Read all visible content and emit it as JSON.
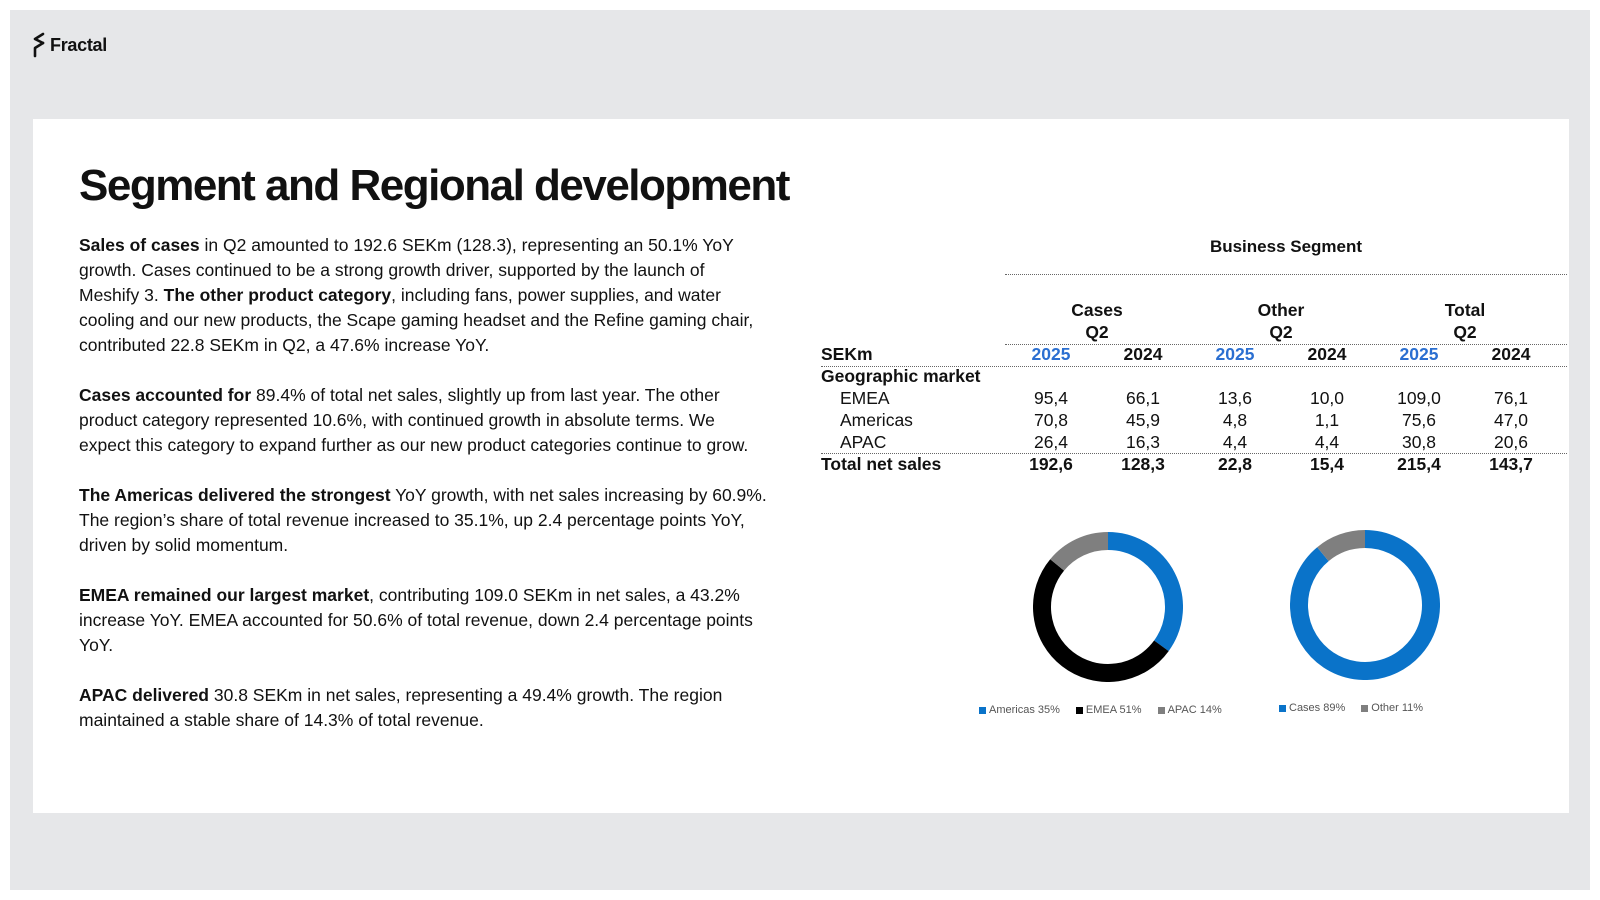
{
  "brand": {
    "name": "Fractal"
  },
  "title": "Segment and Regional development",
  "paragraphs": [
    {
      "bold": "Sales of cases",
      "rest": " in Q2 amounted to 192.6 SEKm (128.3), representing an 50.1% YoY growth. Cases continued to be a strong growth driver, supported by the launch of Meshify 3. ",
      "bold2": "The other product category",
      "rest2": ", including fans, power supplies, and water cooling and our new products, the Scape gaming headset and the Refine gaming chair, contributed 22.8 SEKm in Q2, a 47.6% increase YoY."
    },
    {
      "bold": "Cases accounted for",
      "rest": " 89.4% of total net sales, slightly up from last year. The other product category represented 10.6%, with continued growth in absolute terms. We expect this category to expand further as our new product categories continue to grow."
    },
    {
      "bold": "The Americas delivered the strongest",
      "rest": " YoY growth, with net sales increasing by 60.9%. The region’s share of total revenue increased to 35.1%, up 2.4 percentage points YoY, driven by solid momentum."
    },
    {
      "bold": "EMEA remained our largest market",
      "rest": ", contributing 109.0 SEKm in net sales, a 43.2% increase YoY. EMEA accounted for 50.6% of total revenue, down 2.4 percentage points YoY."
    },
    {
      "bold": "APAC delivered",
      "rest": " 30.8 SEKm in net sales, representing a 49.4% growth. The region maintained a stable share of 14.3% of total revenue."
    }
  ],
  "table": {
    "title": "Business Segment",
    "groups": [
      {
        "name": "Cases",
        "period": "Q2"
      },
      {
        "name": "Other",
        "period": "Q2"
      },
      {
        "name": "Total",
        "period": "Q2"
      }
    ],
    "unit_label": "SEKm",
    "years": [
      "2025",
      "2024",
      "2025",
      "2024",
      "2025",
      "2024"
    ],
    "section_label": "Geographic market",
    "rows": [
      {
        "label": "EMEA",
        "values": [
          "95,4",
          "66,1",
          "13,6",
          "10,0",
          "109,0",
          "76,1"
        ]
      },
      {
        "label": "Americas",
        "values": [
          "70,8",
          "45,9",
          "4,8",
          "1,1",
          "75,6",
          "47,0"
        ]
      },
      {
        "label": "APAC",
        "values": [
          "26,4",
          "16,3",
          "4,4",
          "4,4",
          "30,8",
          "20,6"
        ]
      }
    ],
    "total": {
      "label": "Total net sales",
      "values": [
        "192,6",
        "128,3",
        "22,8",
        "15,4",
        "215,4",
        "143,7"
      ]
    }
  },
  "chart_data": [
    {
      "type": "pie",
      "categories": [
        "Americas",
        "EMEA",
        "APAC"
      ],
      "values": [
        35,
        51,
        14
      ],
      "legend_labels": [
        "Americas 35%",
        "EMEA 51%",
        "APAC 14%"
      ],
      "colors": [
        "#0a73c9",
        "#000000",
        "#7f7f7f"
      ],
      "donut": true,
      "legend": "bottom"
    },
    {
      "type": "pie",
      "categories": [
        "Cases",
        "Other"
      ],
      "values": [
        89,
        11
      ],
      "legend_labels": [
        "Cases 89%",
        "Other 11%"
      ],
      "colors": [
        "#0a73c9",
        "#7f7f7f"
      ],
      "donut": true,
      "legend": "bottom"
    }
  ]
}
